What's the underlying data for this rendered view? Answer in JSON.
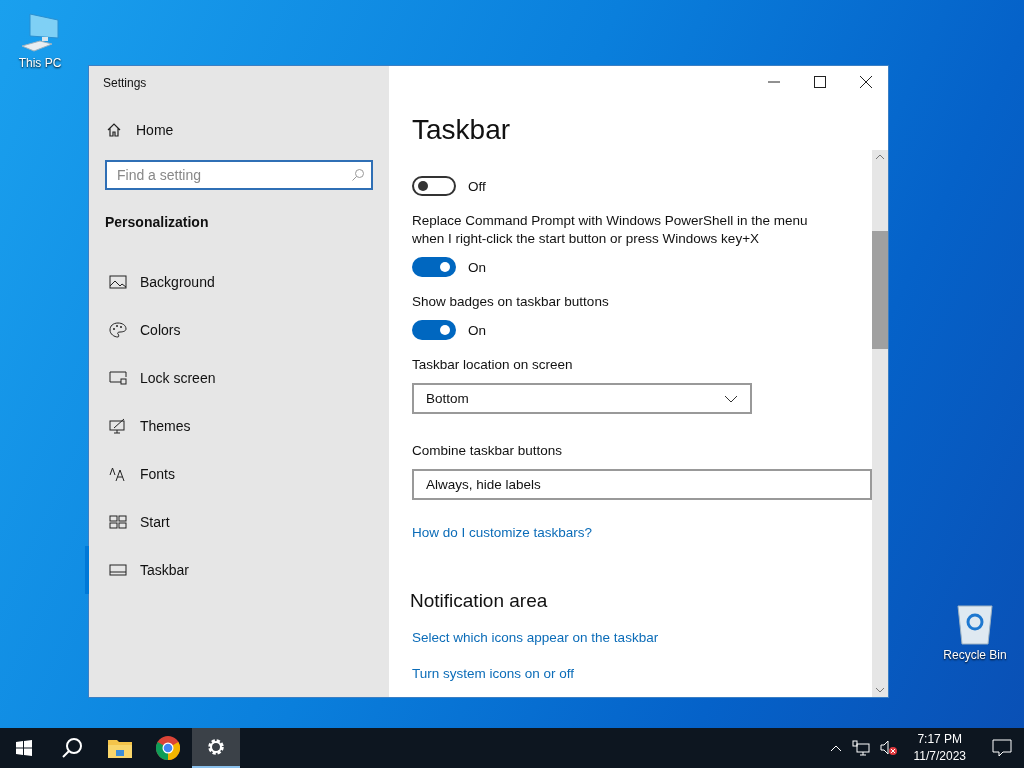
{
  "desktop_icons": [
    {
      "kind": "computer",
      "label": "This PC"
    },
    {
      "kind": "recycle",
      "label": "Recycle Bin"
    }
  ],
  "window": {
    "title": "Settings"
  },
  "sidebar": {
    "home": "Home",
    "search": {
      "placeholder": "Find a setting"
    },
    "section": "Personalization",
    "items": [
      {
        "kind": "picture",
        "label": "Background",
        "selected": false
      },
      {
        "kind": "palette",
        "label": "Colors",
        "selected": false
      },
      {
        "kind": "lock",
        "label": "Lock screen",
        "selected": false
      },
      {
        "kind": "themes",
        "label": "Themes",
        "selected": false
      },
      {
        "kind": "fonts",
        "label": "Fonts",
        "selected": false
      },
      {
        "kind": "start",
        "label": "Start",
        "selected": false
      },
      {
        "kind": "taskbar",
        "label": "Taskbar",
        "selected": true
      }
    ]
  },
  "content": {
    "title": "Taskbar",
    "settings": [
      {
        "kind": "toggle",
        "on": false,
        "state": "Off"
      },
      {
        "kind": "toggle",
        "label": "Replace Command Prompt with Windows PowerShell in the menu when I right-click the start button or press Windows key+X",
        "on": true,
        "state": "On"
      },
      {
        "kind": "toggle",
        "label": "Show badges on taskbar buttons",
        "on": true,
        "state": "On"
      },
      {
        "kind": "dropdown",
        "label": "Taskbar location on screen",
        "value": "Bottom",
        "wide": false
      },
      {
        "kind": "dropdown",
        "label": "Combine taskbar buttons",
        "value": "Always, hide labels",
        "wide": true
      },
      {
        "kind": "link",
        "text": "How do I customize taskbars?"
      },
      {
        "kind": "heading",
        "text": "Notification area"
      },
      {
        "kind": "link",
        "text": "Select which icons appear on the taskbar"
      },
      {
        "kind": "link",
        "text": "Turn system icons on or off"
      }
    ]
  },
  "taskbar": {
    "apps": [
      {
        "kind": "start",
        "active": false
      },
      {
        "kind": "search",
        "active": false
      },
      {
        "kind": "explorer",
        "active": false
      },
      {
        "kind": "chrome",
        "active": false
      },
      {
        "kind": "settings",
        "active": true
      }
    ],
    "time": "7:17 PM",
    "date": "11/7/2023"
  }
}
